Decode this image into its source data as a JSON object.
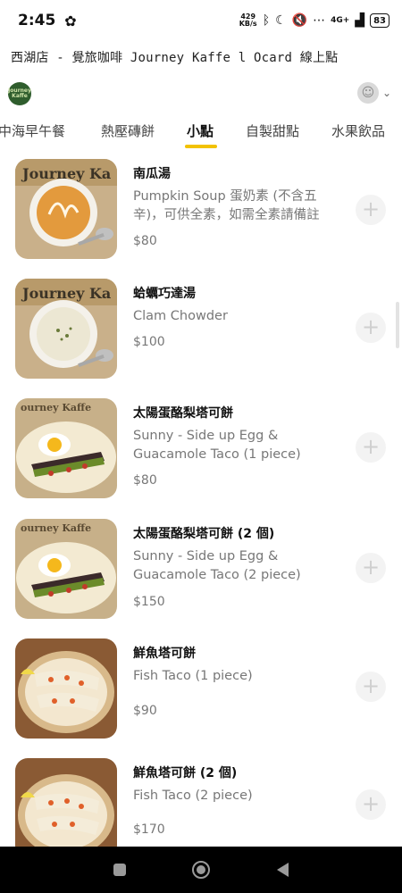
{
  "status_bar": {
    "time": "2:45",
    "net_speed_value": "429",
    "net_speed_unit": "KB/s",
    "network": "4G+",
    "battery": "83"
  },
  "page_title": "西湖店 - 覺旅咖啡 Journey Kaffe l Ocard 線上點",
  "header": {
    "logo_text": "Journey Kaffe",
    "chevron": "⌄"
  },
  "tabs": [
    {
      "label": "中海早午餐"
    },
    {
      "label": "熱壓磚餅"
    },
    {
      "label": "小點"
    },
    {
      "label": "自製甜點"
    },
    {
      "label": "水果飲品"
    }
  ],
  "menu_items": [
    {
      "name": "南瓜湯",
      "description": "Pumpkin Soup 蛋奶素 (不含五辛)，可供全素，如需全素請備註",
      "price": "$80",
      "image": "pumpkin-soup"
    },
    {
      "name": "蛤蠣巧達湯",
      "description": "Clam Chowder",
      "price": "$100",
      "image": "clam-chowder"
    },
    {
      "name": "太陽蛋酪梨塔可餅",
      "description": "Sunny - Side up Egg & Guacamole Taco (1 piece)",
      "price": "$80",
      "image": "egg-taco"
    },
    {
      "name": "太陽蛋酪梨塔可餅 (2 個)",
      "description": "Sunny - Side up Egg & Guacamole Taco (2 piece)",
      "price": "$150",
      "image": "egg-taco"
    },
    {
      "name": "鮮魚塔可餅",
      "description": "Fish Taco (1 piece)",
      "price": "$90",
      "image": "fish-taco"
    },
    {
      "name": "鮮魚塔可餅 (2 個)",
      "description": "Fish Taco (2 piece)",
      "price": "$170",
      "image": "fish-taco"
    }
  ],
  "add_button_symbol": "+",
  "colors": {
    "tab_active_underline": "#f2c200",
    "logo_green": "#2f5d2d",
    "price_gray": "#777777",
    "nav_bar": "#000000"
  }
}
